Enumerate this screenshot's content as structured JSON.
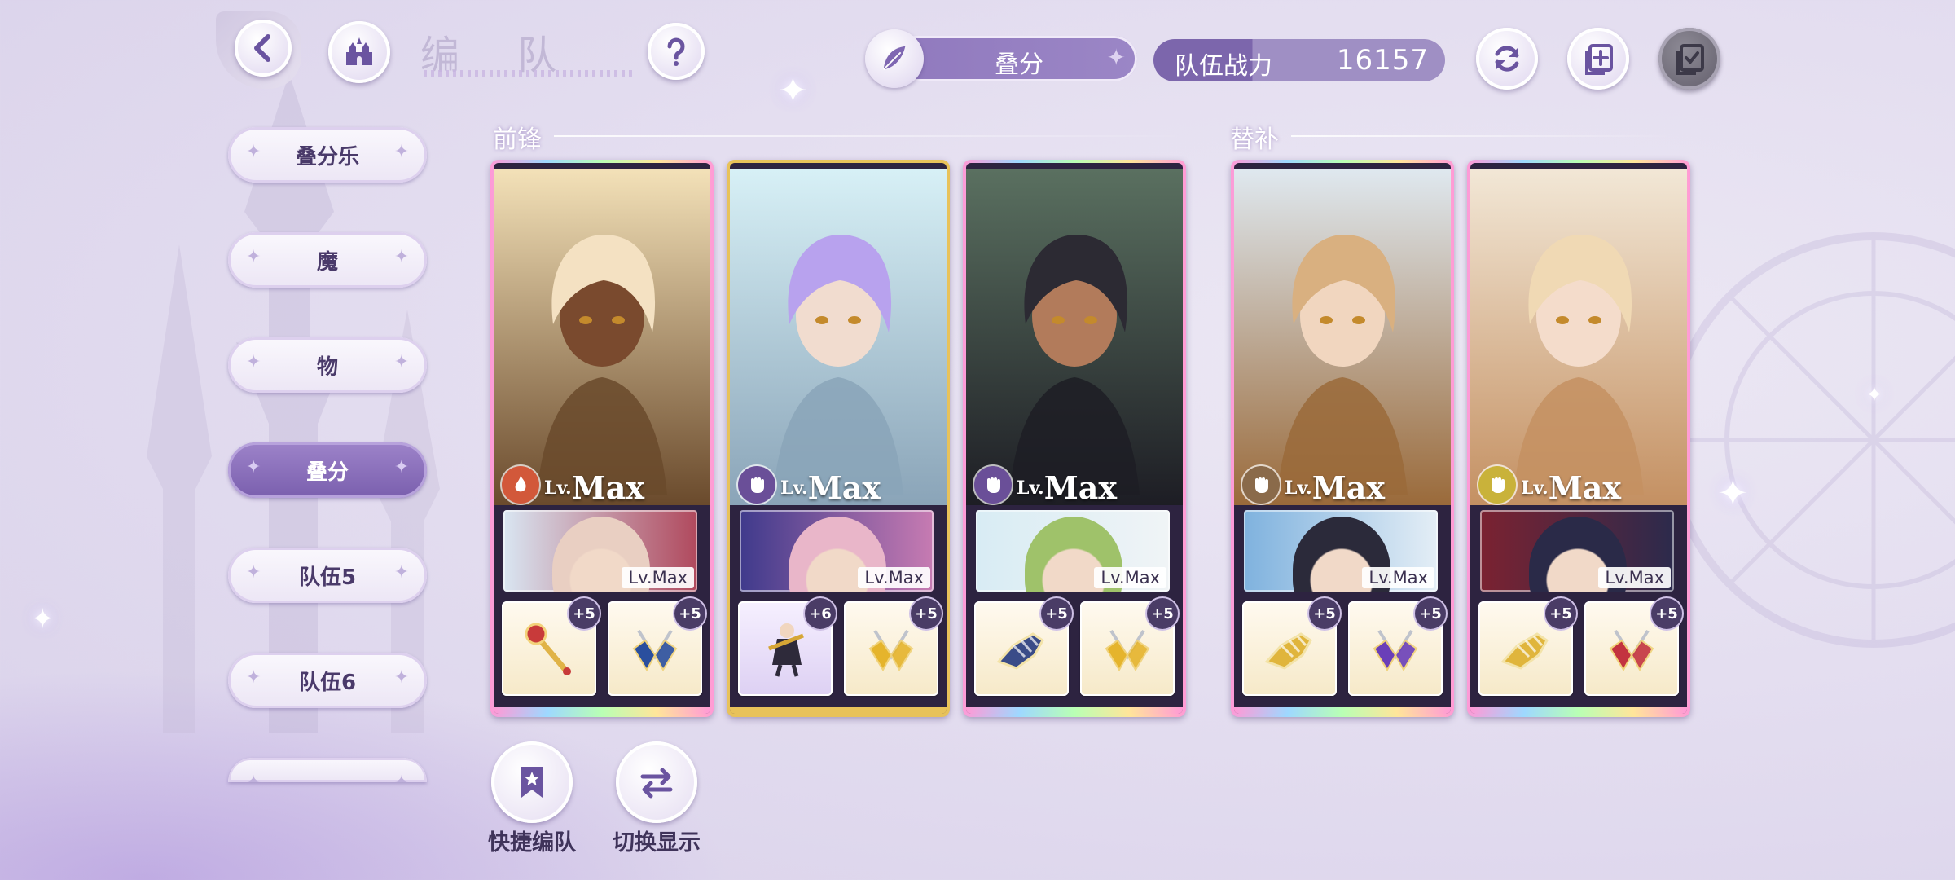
{
  "header": {
    "title": "编 队",
    "team_selector": "叠分",
    "power_label": "队伍战力",
    "power_value": "16157"
  },
  "sidebar": {
    "tabs": [
      {
        "label": "叠分乐",
        "active": false
      },
      {
        "label": "魔",
        "active": false
      },
      {
        "label": "物",
        "active": false
      },
      {
        "label": "叠分",
        "active": true
      },
      {
        "label": "队伍5",
        "active": false
      },
      {
        "label": "队伍6",
        "active": false
      }
    ]
  },
  "sections": {
    "front": "前锋",
    "bench": "替补"
  },
  "cards": [
    {
      "level_prefix": "Lv.",
      "level": "Max",
      "element": "fire-element-icon",
      "element_color": "#d2583a",
      "frame": "rainbow",
      "bg": [
        "#f3e1b8",
        "#6a4a2c"
      ],
      "hair": "#f4e1c2",
      "skin": "#7a4a2e",
      "sub_level": "Lv.Max",
      "sub_bg": [
        "#d9e6f2",
        "#b0495d"
      ],
      "sub_hair": "#e9cfc2",
      "equip": [
        {
          "icon": "scepter-icon",
          "plus": "+5",
          "color": "#c83a3a"
        },
        {
          "icon": "gem-blue-icon",
          "plus": "+5",
          "color": "#2a4f9e"
        }
      ]
    },
    {
      "level_prefix": "Lv.",
      "level": "Max",
      "element": "fist-element-icon",
      "element_color": "#6a4f98",
      "frame": "gold",
      "bg": [
        "#d7f0f6",
        "#8aa4b8"
      ],
      "hair": "#b8a2ee",
      "skin": "#f1dccf",
      "sub_level": "Lv.Max",
      "sub_bg": [
        "#3f3a8c",
        "#c77bb2"
      ],
      "sub_hair": "#e9b6c9",
      "equip": [
        {
          "icon": "knight-figure-icon",
          "plus": "+6",
          "color": "#d6a635"
        },
        {
          "icon": "gem-gold-icon",
          "plus": "+5",
          "color": "#e5b42c"
        }
      ]
    },
    {
      "level_prefix": "Lv.",
      "level": "Max",
      "element": "fist-element-icon",
      "element_color": "#6a4f98",
      "frame": "rainbow",
      "bg": [
        "#5a7060",
        "#1d1d24"
      ],
      "hair": "#2c2a33",
      "skin": "#b27b5b",
      "sub_level": "Lv.Max",
      "sub_bg": [
        "#d8ecf4",
        "#f0f4f6"
      ],
      "sub_hair": "#9fc26a",
      "equip": [
        {
          "icon": "gauntlet-icon",
          "plus": "+5",
          "color": "#3a4c88"
        },
        {
          "icon": "gem-gold-icon",
          "plus": "+5",
          "color": "#e5b42c"
        }
      ]
    },
    {
      "level_prefix": "Lv.",
      "level": "Max",
      "element": "fist-element-icon",
      "element_color": "#8a6a4a",
      "frame": "rainbow",
      "bg": [
        "#dfe8ef",
        "#9a6a3a"
      ],
      "hair": "#d9b080",
      "skin": "#f1d6bf",
      "sub_level": "Lv.Max",
      "sub_bg": [
        "#7fb2de",
        "#e4eef6"
      ],
      "sub_hair": "#2b2a3a",
      "equip": [
        {
          "icon": "gauntlet-gold-icon",
          "plus": "+5",
          "color": "#e0b53c"
        },
        {
          "icon": "gem-purple-icon",
          "plus": "+5",
          "color": "#6a3fb8"
        }
      ]
    },
    {
      "level_prefix": "Lv.",
      "level": "Max",
      "element": "fist-element-icon",
      "element_color": "#c9b23a",
      "frame": "rainbow",
      "bg": [
        "#f2e7d6",
        "#c49062"
      ],
      "hair": "#f0d9b4",
      "skin": "#f4dccb",
      "sub_level": "Lv.Max",
      "sub_bg": [
        "#7b2231",
        "#2c2a4c"
      ],
      "sub_hair": "#2a2a48",
      "equip": [
        {
          "icon": "gauntlet-gold-icon",
          "plus": "+5",
          "color": "#e0b53c"
        },
        {
          "icon": "gem-red-icon",
          "plus": "+5",
          "color": "#c3333f"
        }
      ]
    }
  ],
  "bottom_buttons": {
    "quick_team": "快捷编队",
    "switch_display": "切换显示"
  }
}
